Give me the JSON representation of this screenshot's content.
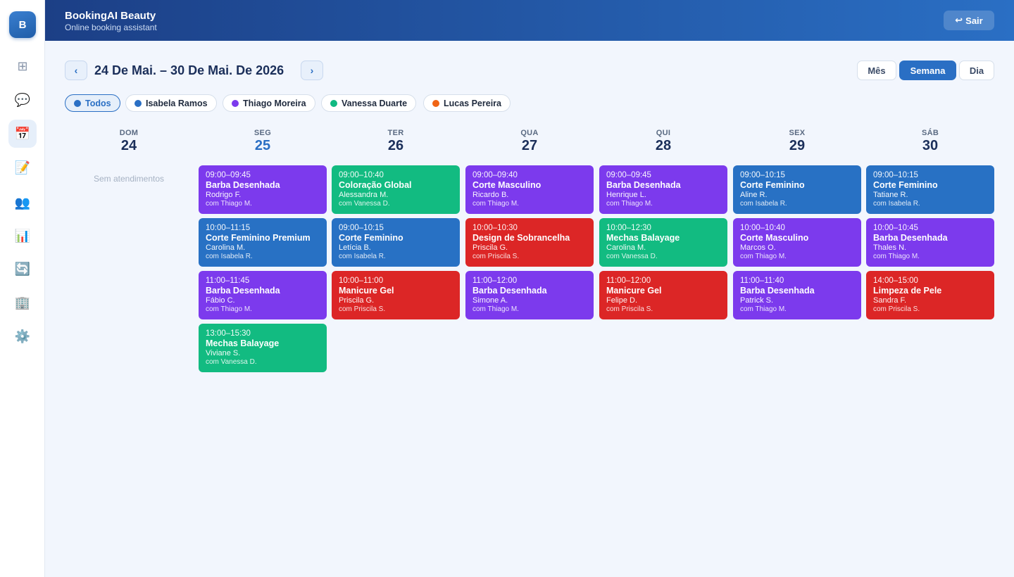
{
  "app": {
    "logo_letter": "B",
    "title": "BookingAI Beauty",
    "subtitle": "Online booking assistant",
    "logout_icon": "↩",
    "logout_label": "Sair"
  },
  "sidebar": {
    "items": [
      {
        "icon": "grid-icon",
        "glyph": "⊞"
      },
      {
        "icon": "chat-icon",
        "glyph": "💬"
      },
      {
        "icon": "calendar-icon",
        "glyph": "📅",
        "active": true
      },
      {
        "icon": "notes-icon",
        "glyph": "📝"
      },
      {
        "icon": "users-icon",
        "glyph": "👥"
      },
      {
        "icon": "chart-icon",
        "glyph": "📊"
      },
      {
        "icon": "sync-icon",
        "glyph": "🔄"
      },
      {
        "icon": "building-icon",
        "glyph": "🏢"
      },
      {
        "icon": "settings-icon",
        "glyph": "⚙️"
      }
    ]
  },
  "toolbar": {
    "prev": "‹",
    "next": "›",
    "range_title": "24 De Mai. – 30 De Mai. De 2026",
    "views": [
      {
        "label": "Mês",
        "active": false
      },
      {
        "label": "Semana",
        "active": true
      },
      {
        "label": "Dia",
        "active": false
      }
    ]
  },
  "filters": [
    {
      "label": "Todos",
      "color": "#2a6fc4",
      "active": true
    },
    {
      "label": "Isabela Ramos",
      "color": "#2a6fc4",
      "active": false
    },
    {
      "label": "Thiago Moreira",
      "color": "#7c3aed",
      "active": false
    },
    {
      "label": "Vanessa Duarte",
      "color": "#10b981",
      "active": false
    },
    {
      "label": "Lucas Pereira",
      "color": "#f06414",
      "active": false
    }
  ],
  "colors": {
    "blue": "#2871c4",
    "purple": "#7c3aed",
    "green": "#12bb81",
    "red": "#dc2626"
  },
  "days": [
    {
      "name": "DOM",
      "num": "24",
      "today": false,
      "empty": "Sem atendimentos",
      "appointments": []
    },
    {
      "name": "SEG",
      "num": "25",
      "today": true,
      "appointments": [
        {
          "time": "09:00–09:45",
          "service": "Barba Desenhada",
          "client": "Rodrigo F.",
          "staff": "com Thiago M.",
          "color": "purple"
        },
        {
          "time": "10:00–11:15",
          "service": "Corte Feminino Premium",
          "client": "Carolina M.",
          "staff": "com Isabela R.",
          "color": "blue"
        },
        {
          "time": "11:00–11:45",
          "service": "Barba Desenhada",
          "client": "Fábio C.",
          "staff": "com Thiago M.",
          "color": "purple"
        },
        {
          "time": "13:00–15:30",
          "service": "Mechas Balayage",
          "client": "Viviane S.",
          "staff": "com Vanessa D.",
          "color": "green"
        }
      ]
    },
    {
      "name": "TER",
      "num": "26",
      "today": false,
      "appointments": [
        {
          "time": "09:00–10:40",
          "service": "Coloração Global",
          "client": "Alessandra M.",
          "staff": "com Vanessa D.",
          "color": "green"
        },
        {
          "time": "09:00–10:15",
          "service": "Corte Feminino",
          "client": "Letícia B.",
          "staff": "com Isabela R.",
          "color": "blue"
        },
        {
          "time": "10:00–11:00",
          "service": "Manicure Gel",
          "client": "Priscila G.",
          "staff": "com Priscila S.",
          "color": "red"
        }
      ]
    },
    {
      "name": "QUA",
      "num": "27",
      "today": false,
      "appointments": [
        {
          "time": "09:00–09:40",
          "service": "Corte Masculino",
          "client": "Ricardo B.",
          "staff": "com Thiago M.",
          "color": "purple"
        },
        {
          "time": "10:00–10:30",
          "service": "Design de Sobrancelha",
          "client": "Priscila G.",
          "staff": "com Priscila S.",
          "color": "red"
        },
        {
          "time": "11:00–12:00",
          "service": "Barba Desenhada",
          "client": "Simone A.",
          "staff": "com Thiago M.",
          "color": "purple"
        }
      ]
    },
    {
      "name": "QUI",
      "num": "28",
      "today": false,
      "appointments": [
        {
          "time": "09:00–09:45",
          "service": "Barba Desenhada",
          "client": "Henrique L.",
          "staff": "com Thiago M.",
          "color": "purple"
        },
        {
          "time": "10:00–12:30",
          "service": "Mechas Balayage",
          "client": "Carolina M.",
          "staff": "com Vanessa D.",
          "color": "green"
        },
        {
          "time": "11:00–12:00",
          "service": "Manicure Gel",
          "client": "Felipe D.",
          "staff": "com Priscila S.",
          "color": "red"
        }
      ]
    },
    {
      "name": "SEX",
      "num": "29",
      "today": false,
      "appointments": [
        {
          "time": "09:00–10:15",
          "service": "Corte Feminino",
          "client": "Aline R.",
          "staff": "com Isabela R.",
          "color": "blue"
        },
        {
          "time": "10:00–10:40",
          "service": "Corte Masculino",
          "client": "Marcos O.",
          "staff": "com Thiago M.",
          "color": "purple"
        },
        {
          "time": "11:00–11:40",
          "service": "Barba Desenhada",
          "client": "Patrick S.",
          "staff": "com Thiago M.",
          "color": "purple"
        }
      ]
    },
    {
      "name": "SÁB",
      "num": "30",
      "today": false,
      "appointments": [
        {
          "time": "09:00–10:15",
          "service": "Corte Feminino",
          "client": "Tatiane R.",
          "staff": "com Isabela R.",
          "color": "blue"
        },
        {
          "time": "10:00–10:45",
          "service": "Barba Desenhada",
          "client": "Thales N.",
          "staff": "com Thiago M.",
          "color": "purple"
        },
        {
          "time": "14:00–15:00",
          "service": "Limpeza de Pele",
          "client": "Sandra F.",
          "staff": "com Priscila S.",
          "color": "red"
        }
      ]
    }
  ]
}
